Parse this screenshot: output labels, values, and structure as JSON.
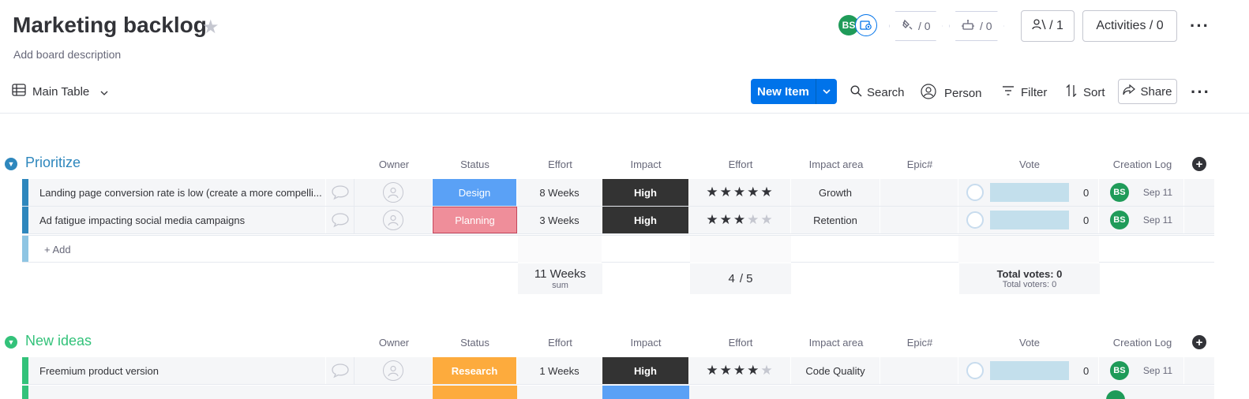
{
  "header": {
    "title": "Marketing backlog",
    "description": "Add board description",
    "avatar_initials": "BS",
    "integrations_count": "/ 0",
    "automations_count": "/ 0",
    "members_count": "/ 1",
    "activities_label": "Activities / 0"
  },
  "toolbar": {
    "view_label": "Main Table",
    "new_item_label": "New Item",
    "search_label": "Search",
    "person_label": "Person",
    "filter_label": "Filter",
    "sort_label": "Sort",
    "share_label": "Share"
  },
  "columns": {
    "owner": "Owner",
    "status": "Status",
    "effort": "Effort",
    "impact": "Impact",
    "effort_rating": "Effort",
    "impact_area": "Impact area",
    "epic": "Epic#",
    "vote": "Vote",
    "creation_log": "Creation Log"
  },
  "colors": {
    "prioritize": "#2e87bd",
    "new_ideas": "#33c27a",
    "design": "#5aa1f6",
    "planning": "#ef8e9a",
    "research": "#fdab3d",
    "high": "#333333"
  },
  "groups": [
    {
      "title": "Prioritize",
      "add_label": "+ Add",
      "rows": [
        {
          "name": "Landing page conversion rate is low (create a more compelli...",
          "status": "Design",
          "effort": "8 Weeks",
          "impact": "High",
          "rating": 5,
          "impact_area": "Growth",
          "votes": "0",
          "creator": "BS",
          "date": "Sep 11"
        },
        {
          "name": "Ad fatigue impacting social media campaigns",
          "status": "Planning",
          "effort": "3 Weeks",
          "impact": "High",
          "rating": 3,
          "impact_area": "Retention",
          "votes": "0",
          "creator": "BS",
          "date": "Sep 11"
        }
      ],
      "summary": {
        "effort_sum": "11 Weeks",
        "effort_sum_label": "sum",
        "rating_avg": "4",
        "rating_max": "/ 5",
        "total_votes": "Total votes: 0",
        "total_voters": "Total voters: 0"
      }
    },
    {
      "title": "New ideas",
      "rows": [
        {
          "name": "Freemium product version",
          "status": "Research",
          "effort": "1 Weeks",
          "impact": "High",
          "rating": 4,
          "impact_area": "Code Quality",
          "votes": "0",
          "creator": "BS",
          "date": "Sep 11"
        }
      ]
    }
  ]
}
